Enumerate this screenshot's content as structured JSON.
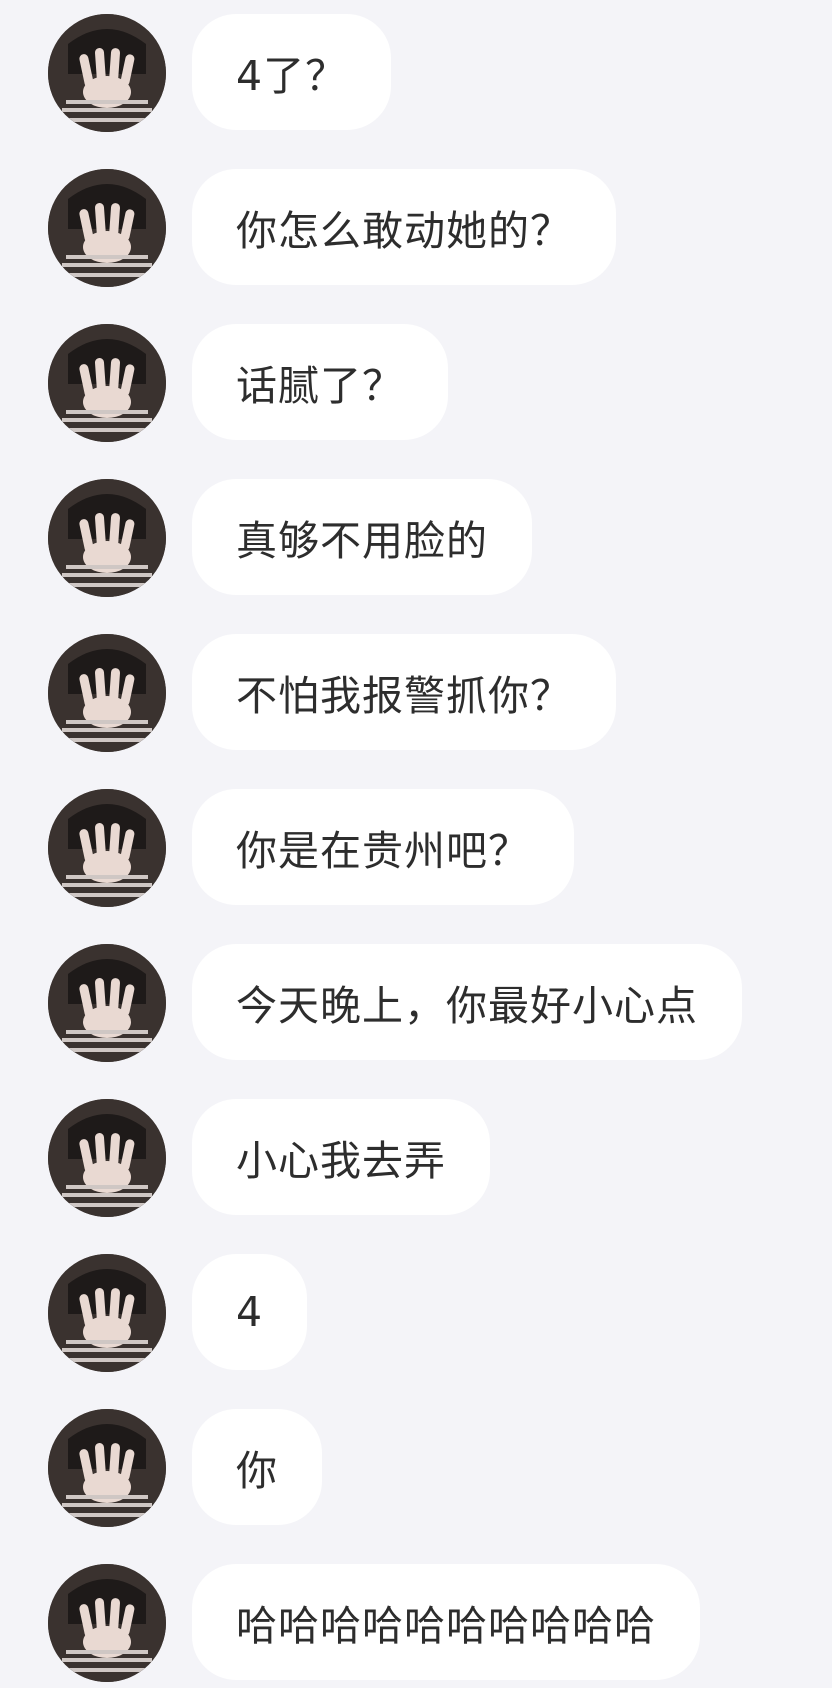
{
  "messages": [
    {
      "text": "4了？"
    },
    {
      "text": "你怎么敢动她的？"
    },
    {
      "text": "话腻了？"
    },
    {
      "text": "真够不用脸的"
    },
    {
      "text": "不怕我报警抓你？"
    },
    {
      "text": "你是在贵州吧？"
    },
    {
      "text": "今天晚上，你最好小心点"
    },
    {
      "text": "小心我去弄"
    },
    {
      "text": "4"
    },
    {
      "text": "你"
    },
    {
      "text": "哈哈哈哈哈哈哈哈哈哈"
    }
  ],
  "colors": {
    "background": "#f4f4f8",
    "bubble": "#ffffff",
    "text": "#2d2d2d"
  },
  "icons": {
    "avatar": "avatar-photo-hand-over-face"
  }
}
